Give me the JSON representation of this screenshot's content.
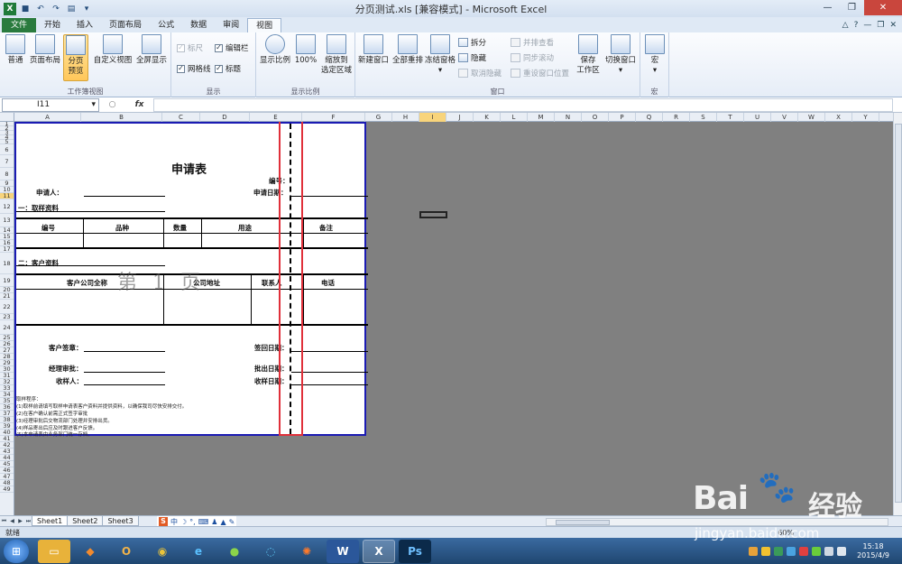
{
  "window": {
    "title": "分页测试.xls  [兼容模式] - Microsoft Excel"
  },
  "ribbon_tabs": [
    "文件",
    "开始",
    "插入",
    "页面布局",
    "公式",
    "数据",
    "审阅",
    "视图"
  ],
  "ribbon": {
    "workbook_views": {
      "group_label": "工作簿视图",
      "normal": "普通",
      "page_layout": "页面布局",
      "page_break_line1": "分页",
      "page_break_line2": "预览",
      "custom_view": "自定义视图",
      "full_screen": "全屏显示"
    },
    "show": {
      "group_label": "显示",
      "ruler": "标尺",
      "formula_bar": "编辑栏",
      "gridlines": "网格线",
      "headings": "标题"
    },
    "zoom": {
      "group_label": "显示比例",
      "zoom": "显示比例",
      "zoom100": "100%",
      "zoom_sel_line1": "缩放到",
      "zoom_sel_line2": "选定区域"
    },
    "window": {
      "group_label": "窗口",
      "new_window": "新建窗口",
      "arrange_all": "全部重排",
      "freeze": "冻结窗格",
      "split": "拆分",
      "hide": "隐藏",
      "unhide": "取消隐藏",
      "side_by_side": "并排查看",
      "sync_scroll": "同步滚动",
      "reset_pos": "重设窗口位置",
      "save_ws_line1": "保存",
      "save_ws_line2": "工作区",
      "switch_window": "切换窗口"
    },
    "macros": {
      "group_label": "宏",
      "macro": "宏"
    }
  },
  "formula_bar": {
    "name_box": "I11",
    "fx": "fx",
    "value": ""
  },
  "columns": [
    "A",
    "B",
    "C",
    "D",
    "E",
    "F",
    "G",
    "H",
    "I",
    "J",
    "K",
    "L",
    "M",
    "N",
    "O",
    "P",
    "Q",
    "R",
    "S",
    "T",
    "U",
    "V",
    "W",
    "X",
    "Y"
  ],
  "selected_column": "I",
  "rows": [
    "1",
    "2",
    "3",
    "4",
    "5",
    "6",
    "7",
    "8",
    "9",
    "10",
    "11",
    "12",
    "13",
    "14",
    "15",
    "16",
    "17",
    "18",
    "19",
    "20",
    "21",
    "22",
    "23",
    "24",
    "25",
    "26",
    "27",
    "28",
    "29",
    "30",
    "31",
    "32",
    "33",
    "34",
    "35",
    "36",
    "37",
    "38",
    "39",
    "40",
    "41",
    "42",
    "43",
    "44",
    "45",
    "46",
    "47",
    "48",
    "49"
  ],
  "selected_row": "11",
  "form": {
    "title": "申请表",
    "number_label": "编号：",
    "applicant_label": "申请人：",
    "apply_date_label": "申请日期：",
    "section1": "一：取样资料",
    "table1_headers": [
      "编号",
      "品种",
      "数量",
      "用途",
      "备注"
    ],
    "section2": "二：客户资料",
    "table2_headers": [
      "客户公司全称",
      "公司地址",
      "联系人",
      "电话"
    ],
    "customer_sign_label": "客户签章：",
    "sign_back_date_label": "签回日期：",
    "manager_label": "经理审批：",
    "approve_date_label": "批出日期：",
    "receiver_label": "收样人：",
    "receive_date_label": "收样日期：",
    "notes": [
      "取样程序：",
      "(1)取样前请填写取样申请表客户资料并提供资料，以确保我司尽快安排交付。",
      "(2)在客户确认前需正式签字审批",
      "(3)经理审批后交物流部门处理并安排出货。",
      "(4)样品寄出后应及时跟进客户反馈。",
      "(5)本申请表由业务部门统一存档。"
    ],
    "page_watermark": "第 1 页"
  },
  "sheets": [
    "Sheet1",
    "Sheet2",
    "Sheet3"
  ],
  "status": {
    "ready": "就绪",
    "zoom": "60%"
  },
  "clock": {
    "time": "15:18",
    "date": "2015/4/9"
  },
  "baidu_watermark": {
    "brand": "Bai",
    "brand_cn": "经验",
    "url": "jingyan.baidu.com"
  },
  "colors": {
    "file_tab": "#2a7b3e",
    "page_border": "#1b1bb3",
    "highlight_box": "#e0303a",
    "selected_header": "#f8d47b"
  }
}
